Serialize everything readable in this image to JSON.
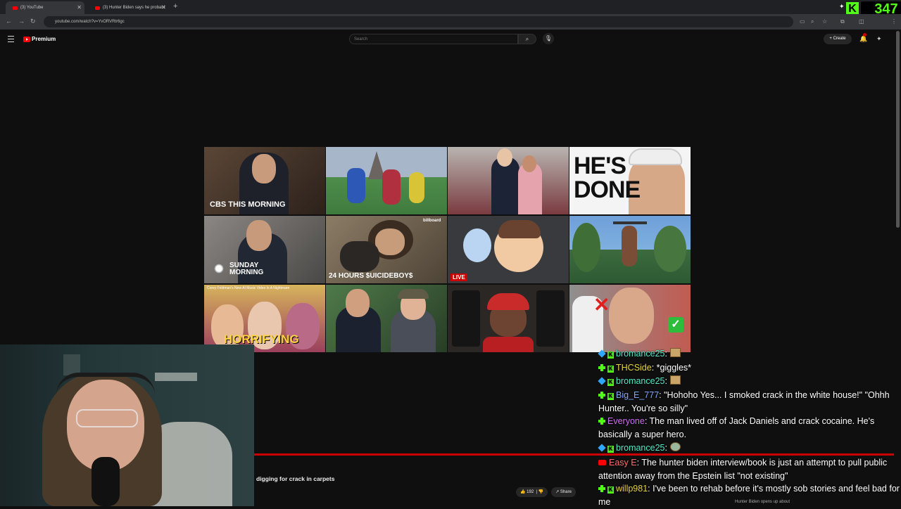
{
  "browser": {
    "tabs": [
      {
        "title": "(3) YouTube",
        "active": true
      },
      {
        "title": "(3) Hunter Biden says he probabl",
        "active": false
      }
    ],
    "url": "youtube.com/watch?v=YvORVRtr6gc"
  },
  "youtube": {
    "logo_text": "Premium",
    "search_placeholder": "Search",
    "create_label": "Create",
    "notification_count": "3",
    "video_title": "digging for crack in carpets",
    "like_count": "192",
    "share_label": "Share",
    "up_next_title": "Hunter Biden opens up about"
  },
  "stream": {
    "kick_viewers": "347"
  },
  "thumbnails": [
    {
      "name": "cbs-morning",
      "text": "CBS THIS MORNING",
      "bg": "#4a3a2e"
    },
    {
      "name": "football-paris",
      "text": "",
      "bg": "#5f8a6a"
    },
    {
      "name": "couple-gallery",
      "text": "",
      "bg": "#8d8a88"
    },
    {
      "name": "hes-done",
      "text": "HE'S DONE",
      "bg": "#ececec"
    },
    {
      "name": "sunday-morning",
      "text": "SUNDAY MORNING",
      "bg": "#6d6a66"
    },
    {
      "name": "24-hours-suicideboys",
      "text": "24 HOURS $UICIDEBOY$",
      "bg": "#6a5d4c"
    },
    {
      "name": "cartoon-live",
      "text": "LIVE",
      "bg": "#3b3d40"
    },
    {
      "name": "workout-palms",
      "text": "",
      "bg": "#4f7a5a"
    },
    {
      "name": "corey-feldman",
      "text": "HORRIFYING",
      "sub": "Corey Feldman's New AI Music Video Is A Nightmare",
      "bg": "#8a4f5c"
    },
    {
      "name": "two-men-suits",
      "text": "",
      "bg": "#3e5e3c"
    },
    {
      "name": "red-cap-speakers",
      "text": "",
      "bg": "#2a2624"
    },
    {
      "name": "fighter-check",
      "text": "",
      "bg": "#7a4e48"
    }
  ],
  "chat": [
    {
      "user": "bromance25",
      "badges": [
        "d",
        "k"
      ],
      "color": "teal",
      "text": "",
      "emote": true
    },
    {
      "user": "THCSide",
      "badges": [
        "g",
        "k"
      ],
      "color": "yellow",
      "text": "*giggles*"
    },
    {
      "user": "bromance25",
      "badges": [
        "d",
        "k"
      ],
      "color": "teal",
      "text": "",
      "emote": true
    },
    {
      "user": "Big_E_777",
      "badges": [
        "g",
        "k"
      ],
      "color": "blue",
      "text": "\"Hohoho Yes... I smoked crack in the white house!\" \"Ohhh Hunter.. You're so silly\""
    },
    {
      "user": "Everyone",
      "badges": [
        "g"
      ],
      "color": "pink",
      "text": "The man lived off of Jack Daniels and crack cocaine. He's basically a super hero."
    },
    {
      "user": "bromance25",
      "badges": [
        "d",
        "k"
      ],
      "color": "teal",
      "text": "",
      "emote": true
    },
    {
      "user": "Easy E",
      "badges": [
        "yt"
      ],
      "color": "red",
      "text": "The hunter biden interview/book is just an attempt to pull public attention away from the Epstein list \"not existing\""
    },
    {
      "user": "willp981",
      "badges": [
        "g",
        "k"
      ],
      "color": "yellow",
      "text": "I've been to rehab before it's mostly sob stories and feel bad for me"
    }
  ]
}
